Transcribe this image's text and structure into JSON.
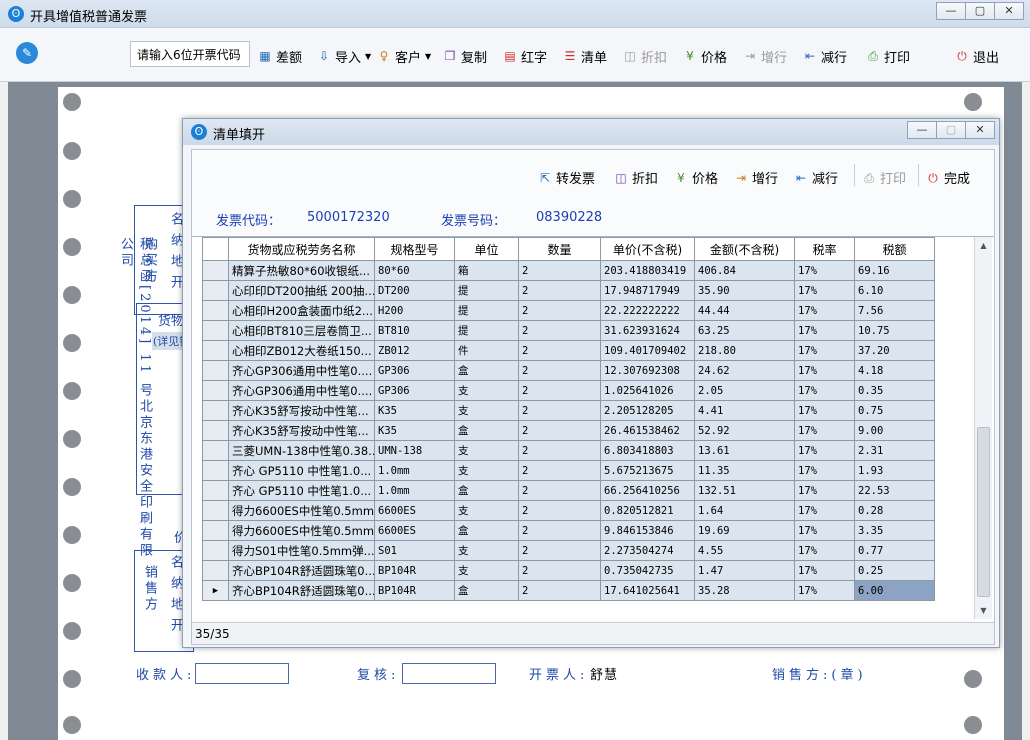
{
  "window": {
    "title": "开具增值税普通发票",
    "controls": {
      "minimize": "—",
      "maximize": "▢",
      "close": "✕"
    }
  },
  "toolbar": {
    "code_input_value": "请输入6位开票代码",
    "buttons": [
      {
        "label": "差额",
        "icon": "▦"
      },
      {
        "label": "导入",
        "icon": "⇩",
        "dropdown": true
      },
      {
        "label": "客户",
        "icon": "♀",
        "dropdown": true
      },
      {
        "label": "复制",
        "icon": "❐"
      },
      {
        "label": "红字",
        "icon": "▤"
      },
      {
        "label": "清单",
        "icon": "☰"
      },
      {
        "label": "折扣",
        "icon": "◫",
        "disabled": true
      },
      {
        "label": "价格",
        "icon": "¥"
      },
      {
        "label": "增行",
        "icon": "⇥",
        "disabled": true
      },
      {
        "label": "减行",
        "icon": "⇤"
      },
      {
        "label": "打印",
        "icon": "⎙"
      },
      {
        "label": "退出",
        "icon": "⏻"
      }
    ]
  },
  "invoice": {
    "side_text": "税总函[2014] 11 号北京东港安全印刷有限公司",
    "buyer_label": "购买方",
    "buyer_fields": "名纳地开",
    "seller_label": "销售方",
    "seller_fields": "名纳地开",
    "goods_header": "货物",
    "goods_row": "(详见销",
    "price_label": "价",
    "footer": {
      "payee": "收款人:",
      "reviewer": "复核:",
      "issuer": "开票人:",
      "issuer_name": "舒慧",
      "seller": "销售方:(章)"
    }
  },
  "dialog": {
    "title": "清单填开",
    "controls": {
      "minimize": "—",
      "maximize": "▢",
      "close": "✕"
    },
    "toolbar": [
      {
        "label": "转发票",
        "icon": "⇱"
      },
      {
        "label": "折扣",
        "icon": "◫"
      },
      {
        "label": "价格",
        "icon": "¥"
      },
      {
        "label": "增行",
        "icon": "⇥"
      },
      {
        "label": "减行",
        "icon": "⇤"
      },
      {
        "label": "打印",
        "icon": "⎙",
        "disabled": true
      },
      {
        "label": "完成",
        "icon": "⏻"
      }
    ],
    "invoice_code_label": "发票代码：",
    "invoice_code": "5000172320",
    "invoice_number_label": "发票号码：",
    "invoice_number": "08390228",
    "columns": [
      "货物或应税劳务名称",
      "规格型号",
      "单位",
      "数量",
      "单价(不含税)",
      "金额(不含税)",
      "税率",
      "税额"
    ],
    "rows": [
      [
        "精算子热敏80*60收银纸...",
        "80*60",
        "箱",
        "2",
        "203.418803419",
        "406.84",
        "17%",
        "69.16"
      ],
      [
        "心印印DT200抽纸 200抽...",
        "DT200",
        "提",
        "2",
        "17.948717949",
        "35.90",
        "17%",
        "6.10"
      ],
      [
        "心相印H200盒装面巾纸2...",
        "H200",
        "提",
        "2",
        "22.222222222",
        "44.44",
        "17%",
        "7.56"
      ],
      [
        "心相印BT810三层卷筒卫...",
        "BT810",
        "提",
        "2",
        "31.623931624",
        "63.25",
        "17%",
        "10.75"
      ],
      [
        "心相印ZB012大卷纸150...",
        "ZB012",
        "件",
        "2",
        "109.401709402",
        "218.80",
        "17%",
        "37.20"
      ],
      [
        "齐心GP306通用中性笔0....",
        "GP306",
        "盒",
        "2",
        "12.307692308",
        "24.62",
        "17%",
        "4.18"
      ],
      [
        "齐心GP306通用中性笔0....",
        "GP306",
        "支",
        "2",
        "1.025641026",
        "2.05",
        "17%",
        "0.35"
      ],
      [
        "齐心K35舒写按动中性笔...",
        "K35",
        "支",
        "2",
        "2.205128205",
        "4.41",
        "17%",
        "0.75"
      ],
      [
        "齐心K35舒写按动中性笔...",
        "K35",
        "盒",
        "2",
        "26.461538462",
        "52.92",
        "17%",
        "9.00"
      ],
      [
        "三菱UMN-138中性笔0.38...",
        "UMN-138",
        "支",
        "2",
        "6.803418803",
        "13.61",
        "17%",
        "2.31"
      ],
      [
        "齐心 GP5110 中性笔1.0...",
        "1.0mm",
        "支",
        "2",
        "5.675213675",
        "11.35",
        "17%",
        "1.93"
      ],
      [
        "齐心 GP5110 中性笔1.0...",
        "1.0mm",
        "盒",
        "2",
        "66.256410256",
        "132.51",
        "17%",
        "22.53"
      ],
      [
        "得力6600ES中性笔0.5mm...",
        "6600ES",
        "支",
        "2",
        "0.820512821",
        "1.64",
        "17%",
        "0.28"
      ],
      [
        "得力6600ES中性笔0.5mm...",
        "6600ES",
        "盒",
        "2",
        "9.846153846",
        "19.69",
        "17%",
        "3.35"
      ],
      [
        "得力S01中性笔0.5mm弹...",
        "S01",
        "支",
        "2",
        "2.273504274",
        "4.55",
        "17%",
        "0.77"
      ],
      [
        "齐心BP104R舒适圆珠笔0...",
        "BP104R",
        "支",
        "2",
        "0.735042735",
        "1.47",
        "17%",
        "0.25"
      ],
      [
        "齐心BP104R舒适圆珠笔0...",
        "BP104R",
        "盒",
        "2",
        "17.641025641",
        "35.28",
        "17%",
        "6.00"
      ]
    ],
    "current_row_marker": "▶",
    "status": "35/35"
  }
}
